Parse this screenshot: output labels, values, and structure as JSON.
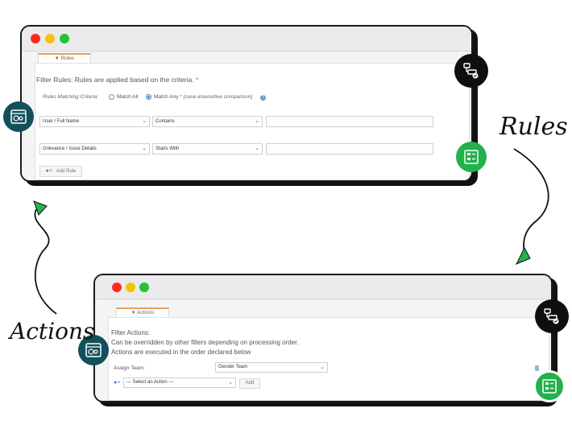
{
  "rules_window": {
    "tab_label": "Rules",
    "title": "Filter Rules: Rules are applied based on the criteria.",
    "required_mark": "*",
    "matching_label": "Rules Matching Criteria:",
    "match_all_label": "Match All",
    "match_any_label": "Match Any",
    "match_any_mark": "*",
    "match_note": "(case-insensitive comparison)",
    "rows": [
      {
        "field": "User / Full Name",
        "operator": "Contains",
        "value": ""
      },
      {
        "field": "Grievance / Issue Details",
        "operator": "Starts With",
        "value": ""
      }
    ],
    "add_rule_label": "Add Rule"
  },
  "actions_window": {
    "tab_label": "Actions",
    "title": "Filter Actions:",
    "line1": "Can be overridden by other filters depending on processing order.",
    "line2": "Actions are executed in the order declared below",
    "assign_label": "Assign Team:",
    "assign_value": "Gender Team",
    "select_action_placeholder": "--- Select an Action ---",
    "add_label": "Add"
  },
  "captions": {
    "rules": "Rules",
    "actions": "Actions"
  },
  "colors": {
    "close": "#ff2a1f",
    "minimize": "#f5c20b",
    "maximize": "#27c23a",
    "teal_badge": "#13505b",
    "black_badge": "#0f0f0f",
    "green_badge": "#22b14c",
    "arrow": "#22b14c",
    "required": "#d9534f"
  }
}
